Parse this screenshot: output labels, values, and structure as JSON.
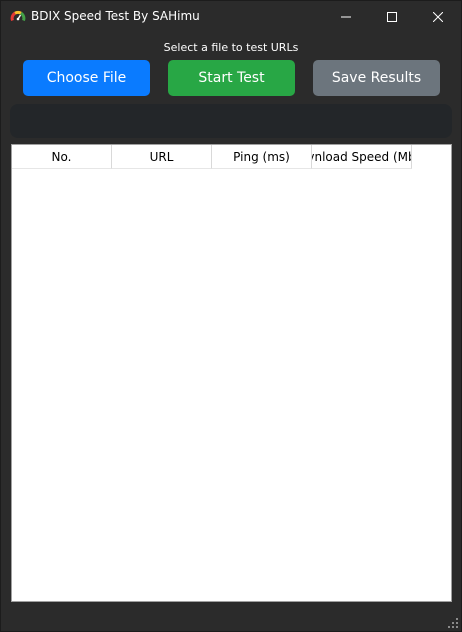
{
  "window": {
    "title": "BDIX Speed Test By SAHimu",
    "app_icon": "gauge-icon",
    "controls": {
      "minimize_icon": "minimize-icon",
      "maximize_icon": "maximize-icon",
      "close_icon": "close-icon"
    }
  },
  "status": {
    "text": "Select a file to test URLs"
  },
  "toolbar": {
    "choose_label": "Choose File",
    "start_label": "Start Test",
    "save_label": "Save Results"
  },
  "progress": {
    "value": 0
  },
  "table": {
    "columns": [
      "No.",
      "URL",
      "Ping (ms)",
      "vnload Speed (Mb"
    ],
    "rows": []
  },
  "colors": {
    "choose_button": "#0a7bff",
    "start_button": "#28a745",
    "save_button": "#6c757d",
    "window_background": "#2b2b2b",
    "progress_track": "#232629"
  }
}
